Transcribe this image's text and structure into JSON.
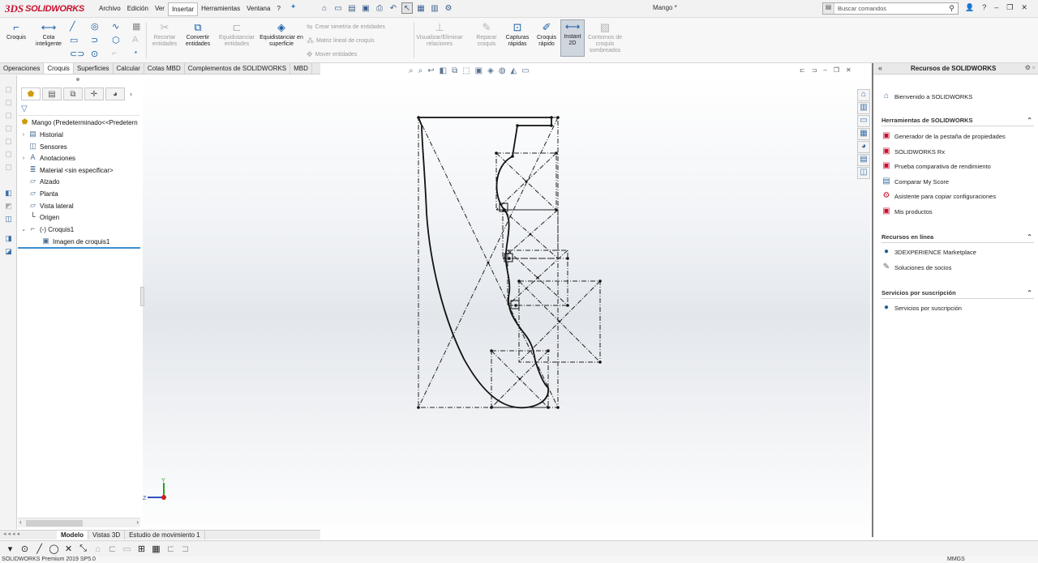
{
  "app": {
    "brand_prefix": "3DS",
    "brand": "SOLIDWORKS",
    "document_title": "Mango *",
    "search_placeholder": "Buscar comandos"
  },
  "menu": [
    "Archivo",
    "Edición",
    "Ver",
    "Insertar",
    "Herramientas",
    "Ventana",
    "?"
  ],
  "menu_active": "Insertar",
  "ribbon": {
    "croquis": "Croquis",
    "cota_inteligente": "Cota inteligente",
    "recortar": "Recortar entidades",
    "convertir": "Convertir entidades",
    "equidistanciar": "Equidistanciar entidades",
    "equidistanciar_superficie": "Equidistanciar en superficie",
    "crear_simetria": "Crear simetría de entidades",
    "matriz_lineal": "Matriz lineal de croquis",
    "mover": "Mover entidades",
    "visualizar_eliminar": "Visualizar/Eliminar relaciones",
    "reparar": "Reparar croquis",
    "capturas": "Capturas rápidas",
    "croquis_rapido": "Croquis rápido",
    "instant2d": "Instant 2D",
    "contornos": "Contornos de croquis sombreados"
  },
  "command_tabs": [
    "Operaciones",
    "Croquis",
    "Superficies",
    "Calcular",
    "Cotas MBD",
    "Complementos de SOLIDWORKS",
    "MBD"
  ],
  "command_tab_active": "Croquis",
  "feature_tree": {
    "root": "Mango  (Predeterminado<<Predetern",
    "items": [
      "Historial",
      "Sensores",
      "Anotaciones",
      "Material <sin especificar>",
      "Alzado",
      "Planta",
      "Vista lateral",
      "Origen",
      "(-) Croquis1",
      "Imagen de croquis1"
    ]
  },
  "bottom_tabs": [
    "Modelo",
    "Vistas 3D",
    "Estudio de movimiento 1"
  ],
  "bottom_tab_active": "Modelo",
  "task_pane": {
    "title": "Recursos de SOLIDWORKS",
    "welcome": "Bienvenido a SOLIDWORKS",
    "sections": [
      {
        "title": "Herramientas de SOLIDWORKS",
        "items": [
          "Generador de la pestaña de propiedades",
          "SOLIDWORKS Rx",
          "Prueba comparativa de rendimiento",
          "Comparar My Score",
          "Asistente para copiar configuraciones",
          "Mis productos"
        ]
      },
      {
        "title": "Recursos en línea",
        "items": [
          "3DEXPERIENCE Marketplace",
          "Soluciones de socios"
        ]
      },
      {
        "title": "Servicios por suscripción",
        "items": [
          "Servicios por suscripción"
        ]
      }
    ]
  },
  "status_bar": {
    "left": "SOLIDWORKS Premium 2019 SP5.0",
    "units": "MMGS"
  },
  "triad": {
    "y": "Y",
    "z": "Z"
  },
  "colors": {
    "brand_red": "#c8102e",
    "accent_blue": "#3a8fd0",
    "sketch_line": "#111111"
  }
}
